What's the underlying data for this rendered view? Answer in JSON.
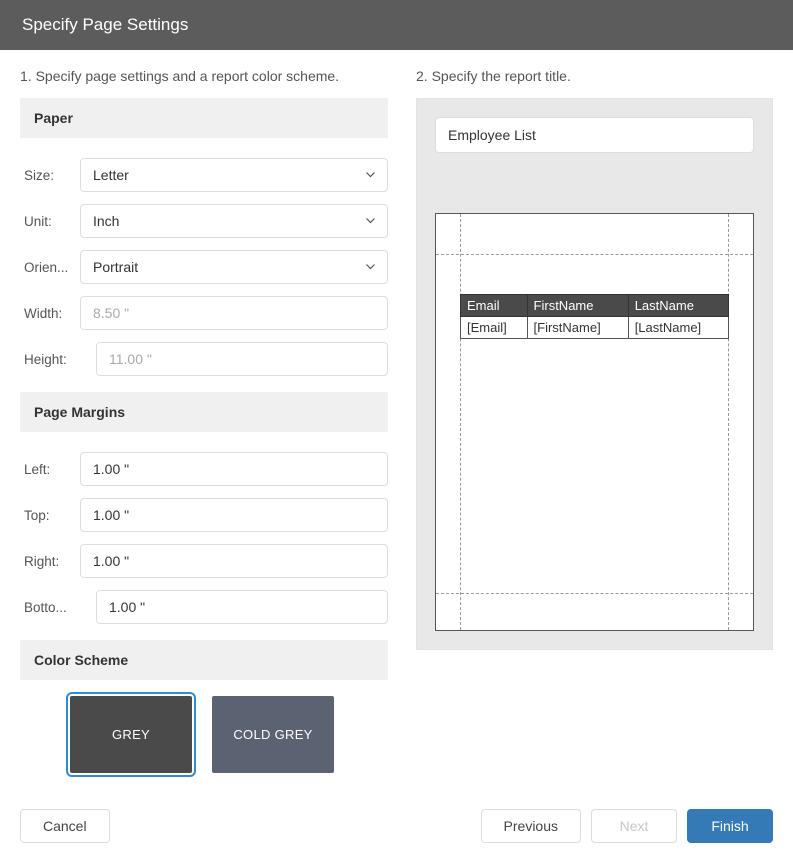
{
  "header": {
    "title": "Specify Page Settings"
  },
  "steps": {
    "left": "1. Specify page settings and a report color scheme.",
    "right": "2. Specify the report title."
  },
  "sections": {
    "paper": "Paper",
    "margins": "Page Margins",
    "color": "Color Scheme"
  },
  "paper": {
    "size_label": "Size:",
    "size_value": "Letter",
    "unit_label": "Unit:",
    "unit_value": "Inch",
    "orientation_label": "Orien...",
    "orientation_value": "Portrait",
    "width_label": "Width:",
    "width_value": "8.50 \"",
    "height_label": "Height:",
    "height_value": "11.00 \""
  },
  "margins": {
    "left_label": "Left:",
    "left_value": "1.00 \"",
    "top_label": "Top:",
    "top_value": "1.00 \"",
    "right_label": "Right:",
    "right_value": "1.00 \"",
    "bottom_label": "Botto...",
    "bottom_value": "1.00 \""
  },
  "colors": {
    "grey": "GREY",
    "coldgrey": "COLD GREY"
  },
  "report": {
    "title_value": "Employee List"
  },
  "preview": {
    "headers": [
      "Email",
      "FirstName",
      "LastName"
    ],
    "row": [
      "[Email]",
      "[FirstName]",
      "[LastName]"
    ]
  },
  "footer": {
    "cancel": "Cancel",
    "previous": "Previous",
    "next": "Next",
    "finish": "Finish"
  }
}
